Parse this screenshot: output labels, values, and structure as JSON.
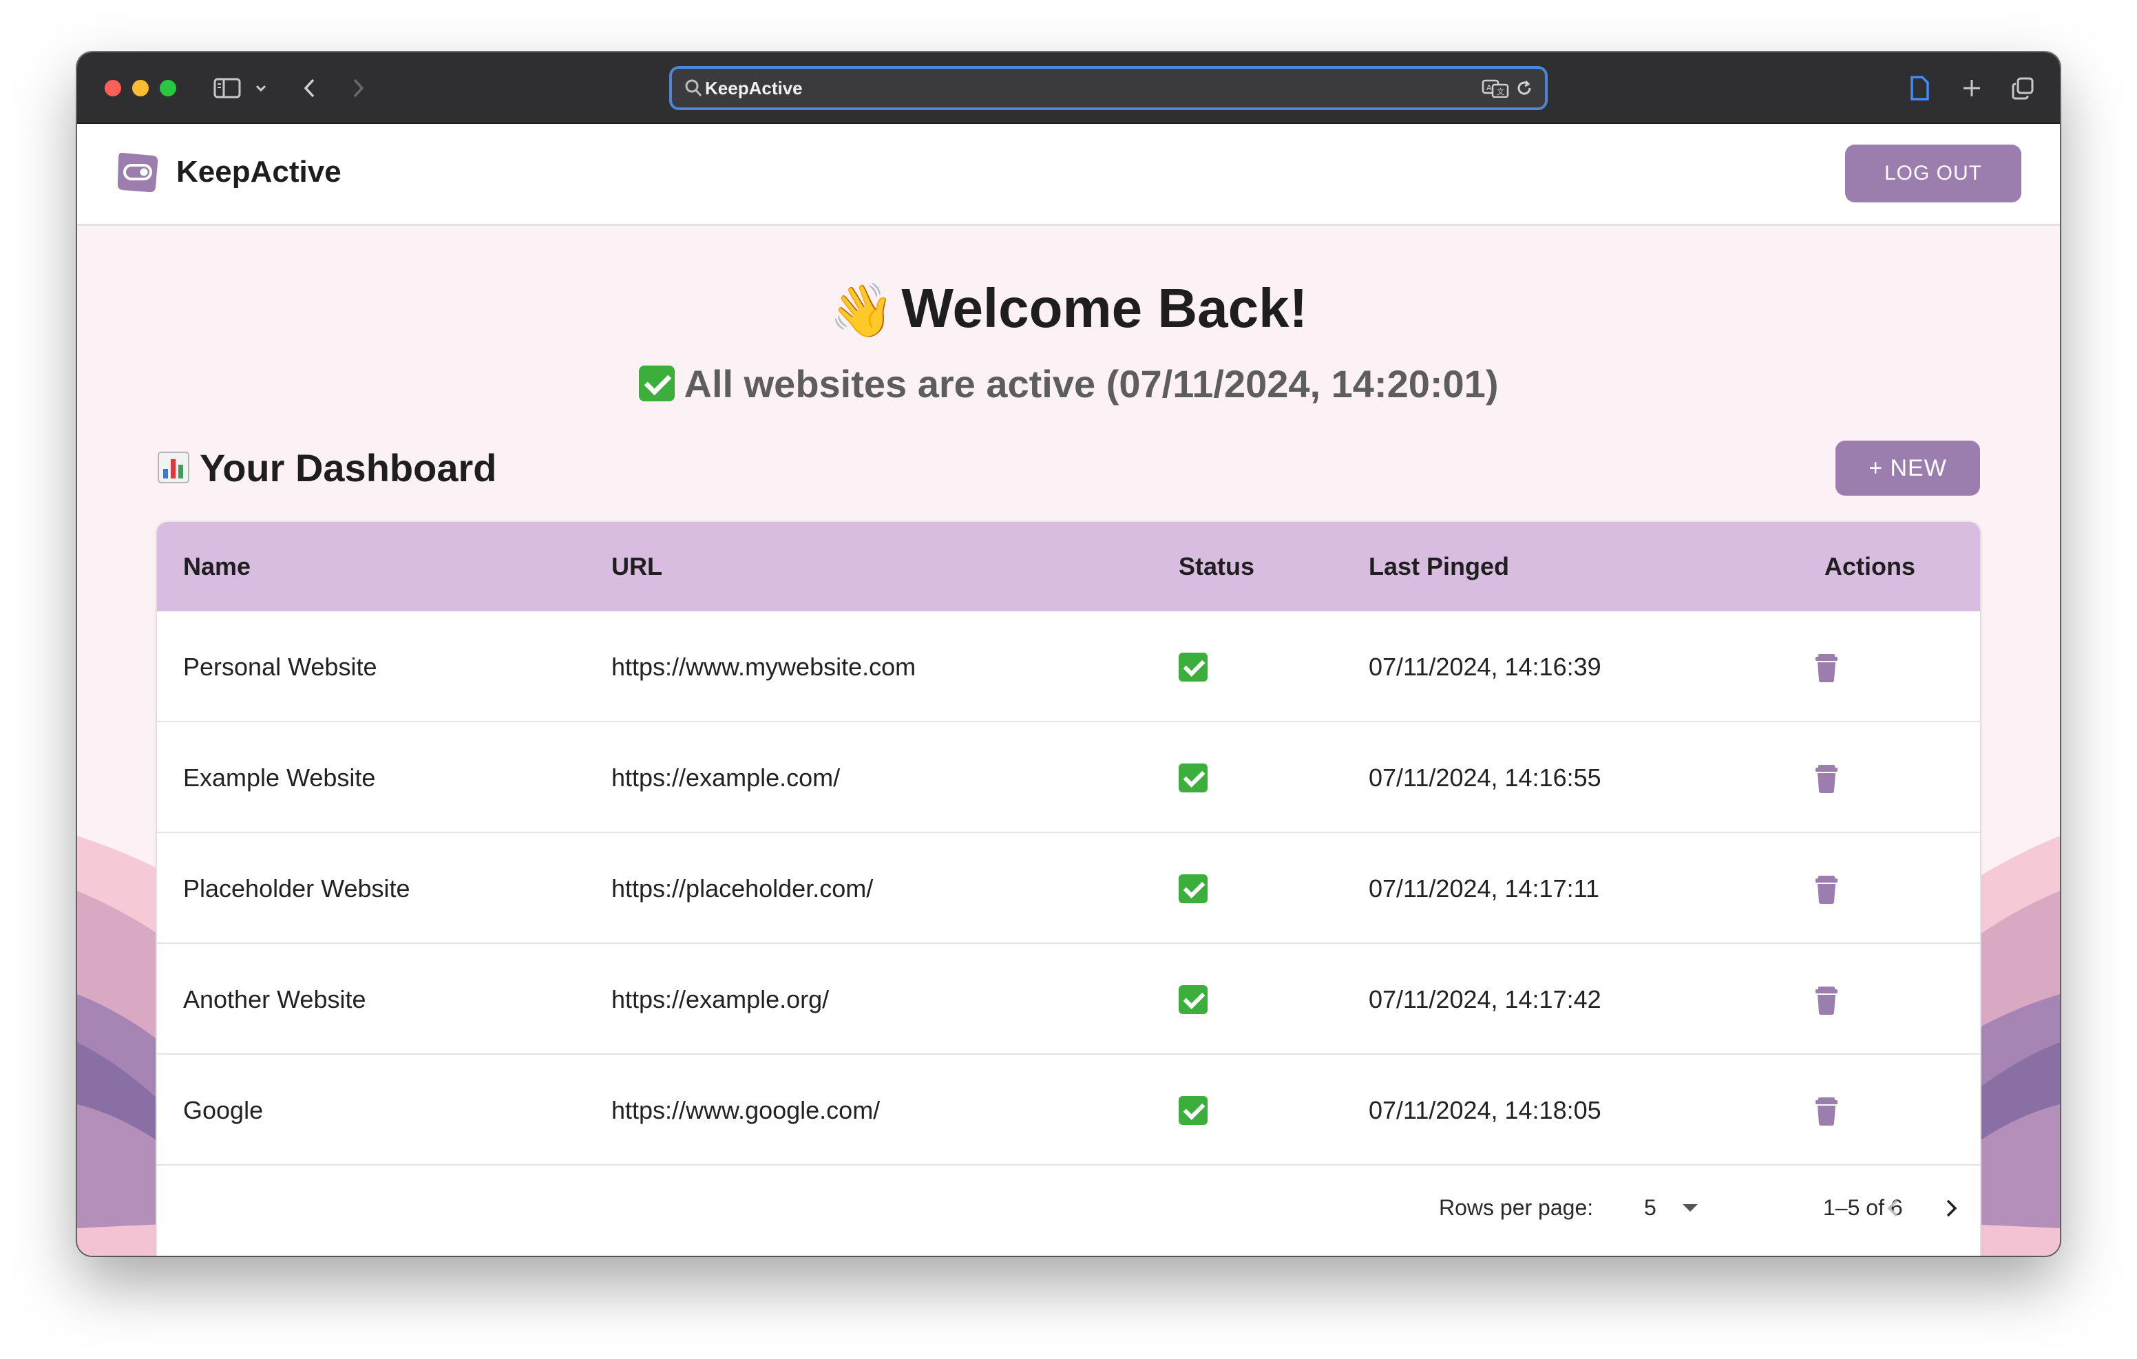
{
  "browser": {
    "url": "KeepActive"
  },
  "app": {
    "brand": "KeepActive",
    "logout_label": "LOG OUT"
  },
  "hero": {
    "welcome": "Welcome Back!",
    "status": "All websites are active (07/11/2024, 14:20:01)"
  },
  "dashboard": {
    "title": "Your Dashboard",
    "new_label": "+  NEW"
  },
  "table": {
    "columns": [
      "Name",
      "URL",
      "Status",
      "Last Pinged",
      "Actions"
    ],
    "rows": [
      {
        "name": "Personal Website",
        "url": "https://www.mywebsite.com",
        "status": "active",
        "last_pinged": "07/11/2024, 14:16:39"
      },
      {
        "name": "Example Website",
        "url": "https://example.com/",
        "status": "active",
        "last_pinged": "07/11/2024, 14:16:55"
      },
      {
        "name": "Placeholder Website",
        "url": "https://placeholder.com/",
        "status": "active",
        "last_pinged": "07/11/2024, 14:17:11"
      },
      {
        "name": "Another Website",
        "url": "https://example.org/",
        "status": "active",
        "last_pinged": "07/11/2024, 14:17:42"
      },
      {
        "name": "Google",
        "url": "https://www.google.com/",
        "status": "active",
        "last_pinged": "07/11/2024, 14:18:05"
      }
    ],
    "footer": {
      "rows_per_page_label": "Rows per page:",
      "rows_per_page_value": "5",
      "range": "1–5 of 6"
    }
  },
  "colors": {
    "accent": "#9b7eae",
    "table_header": "#d9bde1",
    "page_bg": "#fcf1f5",
    "status_ok": "#3cae3c"
  },
  "icons": {
    "logo": "toggle-switch-icon",
    "row_action": "trash-icon",
    "status": "check-mark-icon",
    "welcome": "waving-hand-icon",
    "dashboard": "bar-chart-icon"
  }
}
